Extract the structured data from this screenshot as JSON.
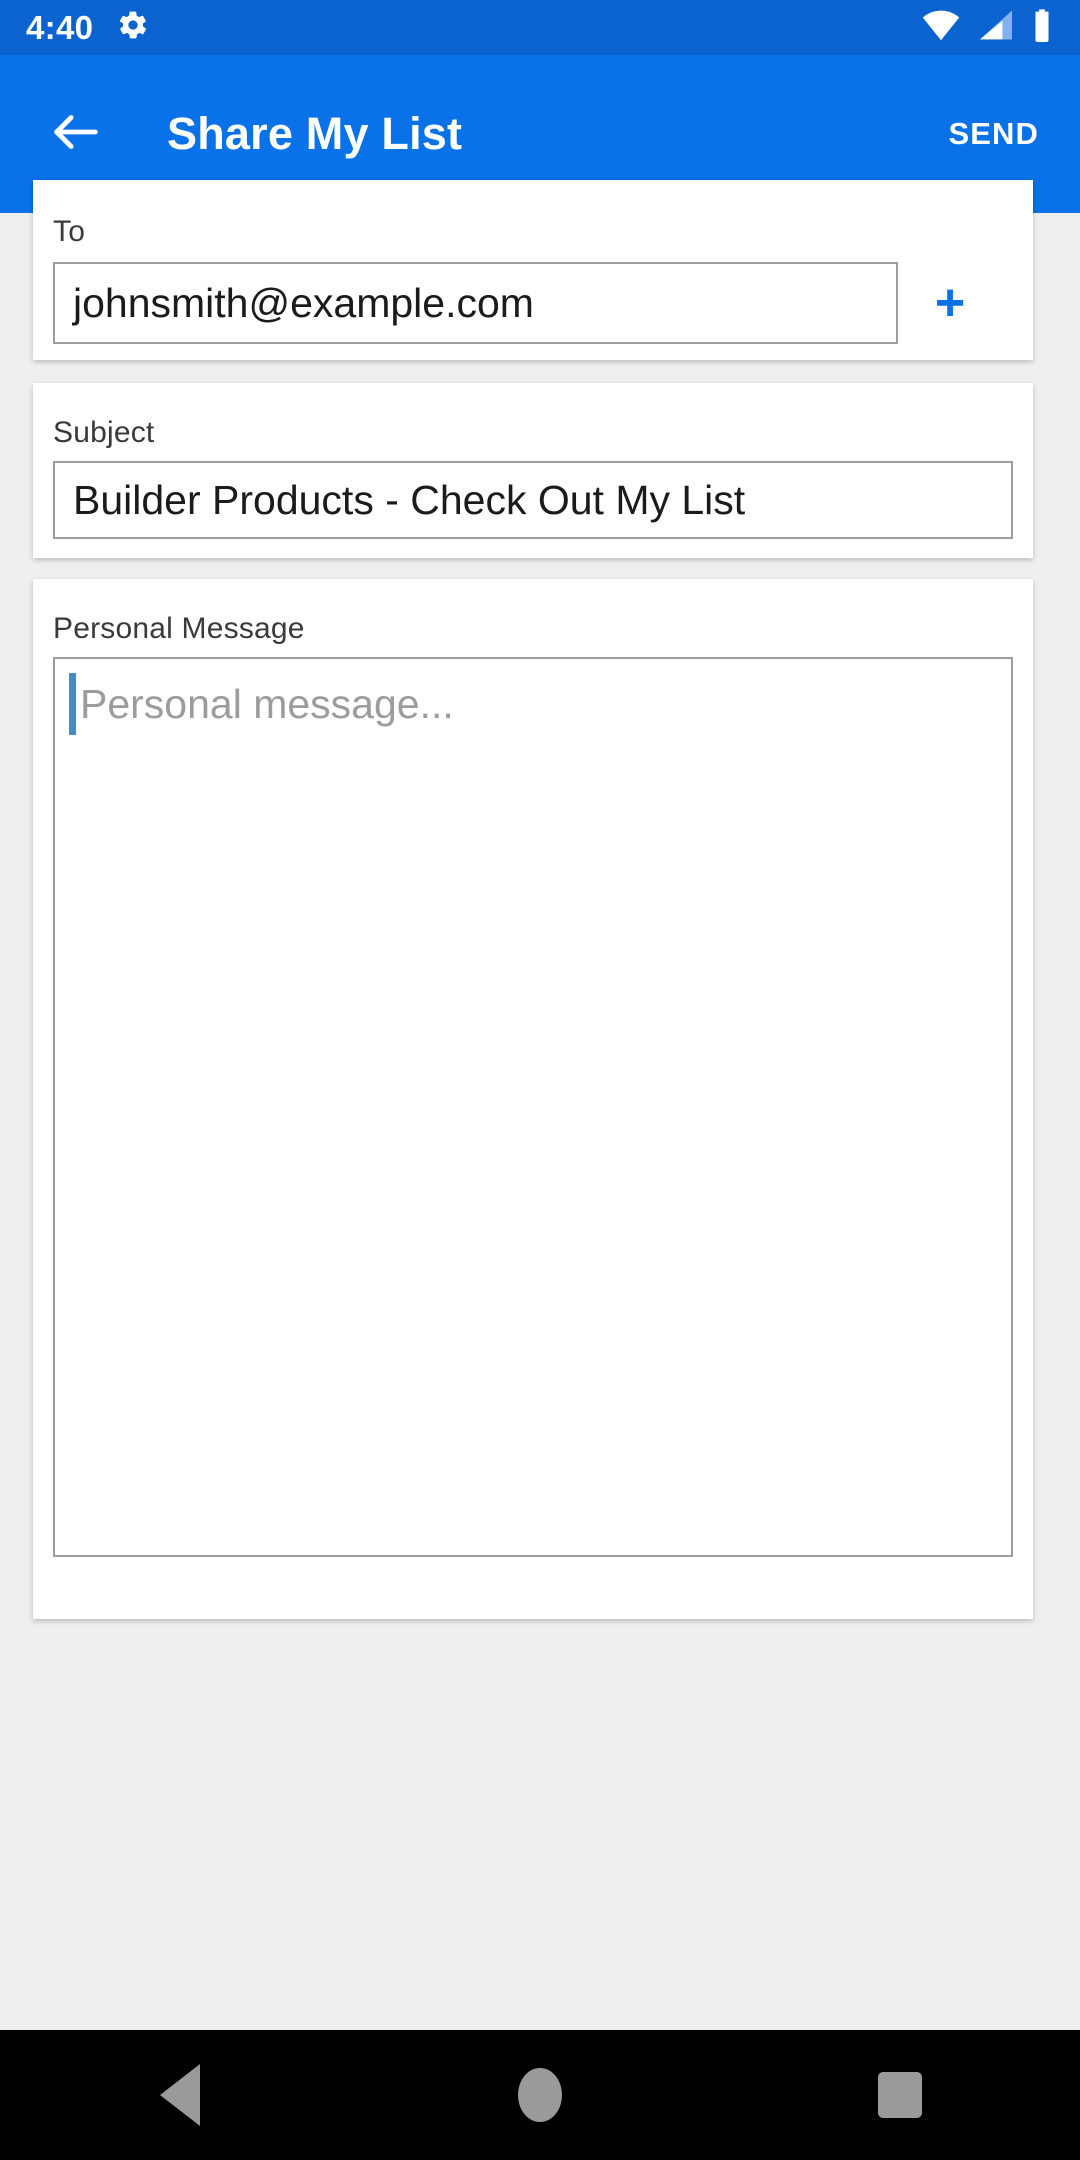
{
  "status_bar": {
    "time": "4:40",
    "icons": {
      "settings": "gear-icon",
      "wifi": "wifi-icon",
      "cellular": "signal-cellular-icon",
      "battery": "battery-full-icon"
    }
  },
  "app_bar": {
    "back_icon": "arrow-back-icon",
    "title": "Share My List",
    "send_label": "SEND",
    "background_color": "#0a72e8",
    "text_color": "#ffffff"
  },
  "form": {
    "to": {
      "label": "To",
      "value": "johnsmith@example.com",
      "placeholder": "",
      "add_icon": "plus-icon",
      "add_icon_color": "#0a72e8"
    },
    "subject": {
      "label": "Subject",
      "value": "Builder Products - Check Out My List",
      "placeholder": ""
    },
    "message": {
      "label": "Personal Message",
      "value": "",
      "placeholder": "Personal message...",
      "caret_color": "#3e8ecb"
    }
  },
  "nav_bar": {
    "back": "nav-back-icon",
    "home": "nav-home-icon",
    "recents": "nav-recents-icon"
  },
  "colors": {
    "status_bar": "#0a63cf",
    "accent": "#0a72e8",
    "page_background": "#efefef",
    "card_background": "#ffffff",
    "input_border": "#9e9e9e",
    "placeholder_text": "#9c9c9c"
  }
}
